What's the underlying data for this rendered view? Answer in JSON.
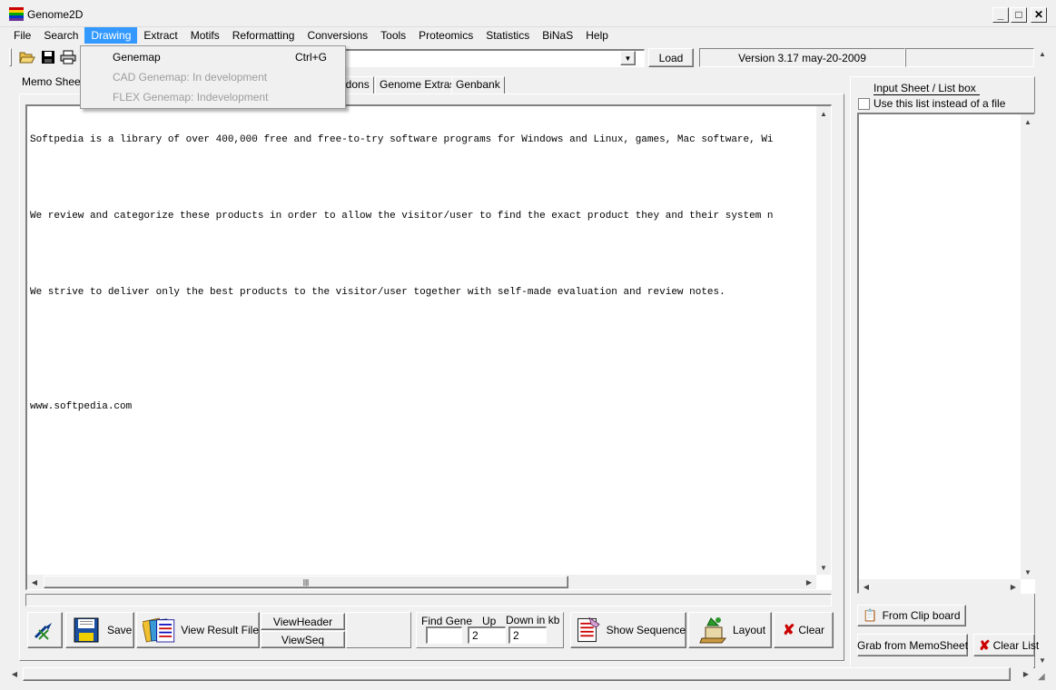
{
  "window": {
    "title": "Genome2D",
    "controls": [
      "minimize",
      "maximize",
      "close"
    ]
  },
  "menu": {
    "items": [
      "File",
      "Search",
      "Drawing",
      "Extract",
      "Motifs",
      "Reformatting",
      "Conversions",
      "Tools",
      "Proteomics",
      "Statistics",
      "BiNaS",
      "Help"
    ],
    "active": "Drawing",
    "dropdown": {
      "items": [
        {
          "label": "Genemap",
          "shortcut": "Ctrl+G",
          "enabled": true
        },
        {
          "label": "CAD Genemap: In development",
          "shortcut": "",
          "enabled": false
        },
        {
          "label": "FLEX Genemap: Indevelopment",
          "shortcut": "",
          "enabled": false
        }
      ]
    }
  },
  "toolbar": {
    "icons": [
      "open-folder-icon",
      "save-disk-icon",
      "print-icon"
    ],
    "combo_value": "",
    "load_label": "Load",
    "version": "Version 3.17   may-20-2009"
  },
  "tabs": {
    "items": [
      "Memo Sheet",
      "odons",
      "Genome Extras",
      "Genbank"
    ],
    "active": "Memo Sheet"
  },
  "memo": {
    "lines": [
      "Softpedia is a library of over 400,000 free and free-to-try software programs for Windows and Linux, games, Mac software, Wi",
      "",
      "We review and categorize these products in order to allow the visitor/user to find the exact product they and their system n",
      "",
      "We strive to deliver only the best products to the visitor/user together with self-made evaluation and review notes.",
      "",
      "",
      "www.softpedia.com"
    ]
  },
  "bottom_toolbar": {
    "save_label": "Save",
    "view_result_label": "View Result File",
    "view_header_label": "ViewHeader",
    "view_seq_label": "ViewSeq",
    "find_gene_label": "Find Gene",
    "up_label": "Up",
    "down_label": "Down in kb",
    "find_gene_value": "",
    "up_value": "2",
    "down_value": "2",
    "show_sequence_label": "Show Sequence",
    "layout_label": "Layout",
    "clear_label": "Clear"
  },
  "right_panel": {
    "title": "Input Sheet / List box",
    "checkbox_label": "Use this list instead of a file",
    "checkbox_checked": false,
    "from_clipboard_label": "From Clip board",
    "grab_memo_label": "Grab from MemoSheet",
    "clear_list_label": "Clear List"
  },
  "colors": {
    "menu_highlight": "#3399ff",
    "clear_x": "#cc0000"
  }
}
